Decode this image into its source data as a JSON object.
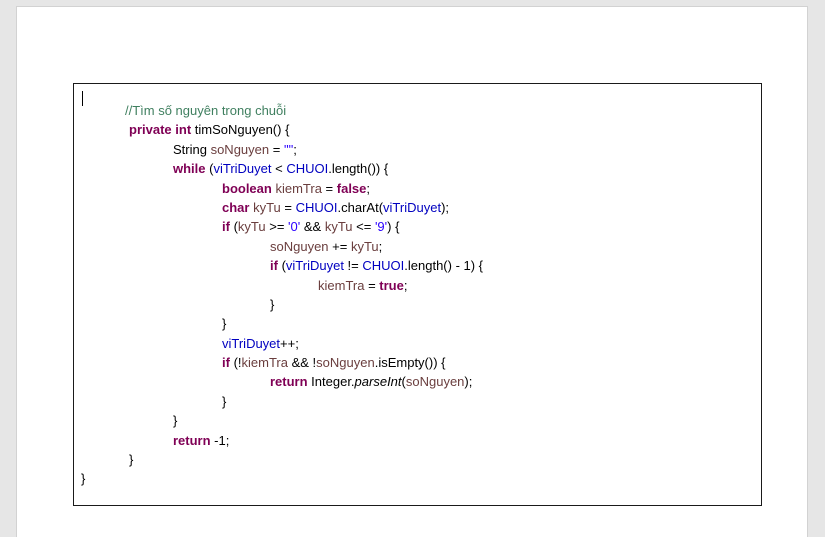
{
  "code": {
    "lines": [
      [
        {
          "c": "cm",
          "t": "//Tìm số nguyên trong chuỗi"
        }
      ],
      [
        {
          "c": "kw",
          "t": "private"
        },
        {
          "c": "",
          "t": " "
        },
        {
          "c": "kw",
          "t": "int"
        },
        {
          "c": "",
          "t": " timSoNguyen() {"
        }
      ],
      [
        {
          "c": "",
          "t": "String "
        },
        {
          "c": "vr",
          "t": "soNguyen"
        },
        {
          "c": "",
          "t": " = "
        },
        {
          "c": "st",
          "t": "\"\""
        },
        {
          "c": "",
          "t": ";"
        }
      ],
      [
        {
          "c": "kw",
          "t": "while"
        },
        {
          "c": "",
          "t": " ("
        },
        {
          "c": "fd",
          "t": "viTriDuyet"
        },
        {
          "c": "",
          "t": " < "
        },
        {
          "c": "fd",
          "t": "CHUOI"
        },
        {
          "c": "",
          "t": ".length()) {"
        }
      ],
      [
        {
          "c": "kw",
          "t": "boolean"
        },
        {
          "c": "",
          "t": " "
        },
        {
          "c": "vr",
          "t": "kiemTra"
        },
        {
          "c": "",
          "t": " = "
        },
        {
          "c": "kw",
          "t": "false"
        },
        {
          "c": "",
          "t": ";"
        }
      ],
      [
        {
          "c": "kw",
          "t": "char"
        },
        {
          "c": "",
          "t": " "
        },
        {
          "c": "vr",
          "t": "kyTu"
        },
        {
          "c": "",
          "t": " = "
        },
        {
          "c": "fd",
          "t": "CHUOI"
        },
        {
          "c": "",
          "t": ".charAt("
        },
        {
          "c": "fd",
          "t": "viTriDuyet"
        },
        {
          "c": "",
          "t": ");"
        }
      ],
      [
        {
          "c": "kw",
          "t": "if"
        },
        {
          "c": "",
          "t": " ("
        },
        {
          "c": "vr",
          "t": "kyTu"
        },
        {
          "c": "",
          "t": " >= "
        },
        {
          "c": "st",
          "t": "'0'"
        },
        {
          "c": "",
          "t": " && "
        },
        {
          "c": "vr",
          "t": "kyTu"
        },
        {
          "c": "",
          "t": " <= "
        },
        {
          "c": "st",
          "t": "'9'"
        },
        {
          "c": "",
          "t": ") {"
        }
      ],
      [
        {
          "c": "vr",
          "t": "soNguyen"
        },
        {
          "c": "",
          "t": " += "
        },
        {
          "c": "vr",
          "t": "kyTu"
        },
        {
          "c": "",
          "t": ";"
        }
      ],
      [
        {
          "c": "kw",
          "t": "if"
        },
        {
          "c": "",
          "t": " ("
        },
        {
          "c": "fd",
          "t": "viTriDuyet"
        },
        {
          "c": "",
          "t": " != "
        },
        {
          "c": "fd",
          "t": "CHUOI"
        },
        {
          "c": "",
          "t": ".length() - 1) {"
        }
      ],
      [
        {
          "c": "vr",
          "t": "kiemTra"
        },
        {
          "c": "",
          "t": " = "
        },
        {
          "c": "kw",
          "t": "true"
        },
        {
          "c": "",
          "t": ";"
        }
      ],
      [
        {
          "c": "",
          "t": "}"
        }
      ],
      [
        {
          "c": "",
          "t": "}"
        }
      ],
      [
        {
          "c": "fd",
          "t": "viTriDuyet"
        },
        {
          "c": "",
          "t": "++;"
        }
      ],
      [
        {
          "c": "kw",
          "t": "if"
        },
        {
          "c": "",
          "t": " (!"
        },
        {
          "c": "vr",
          "t": "kiemTra"
        },
        {
          "c": "",
          "t": " && !"
        },
        {
          "c": "vr",
          "t": "soNguyen"
        },
        {
          "c": "",
          "t": ".isEmpty()) {"
        }
      ],
      [
        {
          "c": "kw",
          "t": "return"
        },
        {
          "c": "",
          "t": " Integer."
        },
        {
          "c": "it",
          "t": "parseInt"
        },
        {
          "c": "",
          "t": "("
        },
        {
          "c": "vr",
          "t": "soNguyen"
        },
        {
          "c": "",
          "t": ");"
        }
      ],
      [
        {
          "c": "",
          "t": "}"
        }
      ],
      [
        {
          "c": "",
          "t": "}"
        }
      ],
      [
        {
          "c": "kw",
          "t": "return"
        },
        {
          "c": "",
          "t": " -1;"
        }
      ],
      [
        {
          "c": "",
          "t": "}"
        }
      ],
      [
        {
          "c": "",
          "t": "}"
        }
      ]
    ]
  }
}
